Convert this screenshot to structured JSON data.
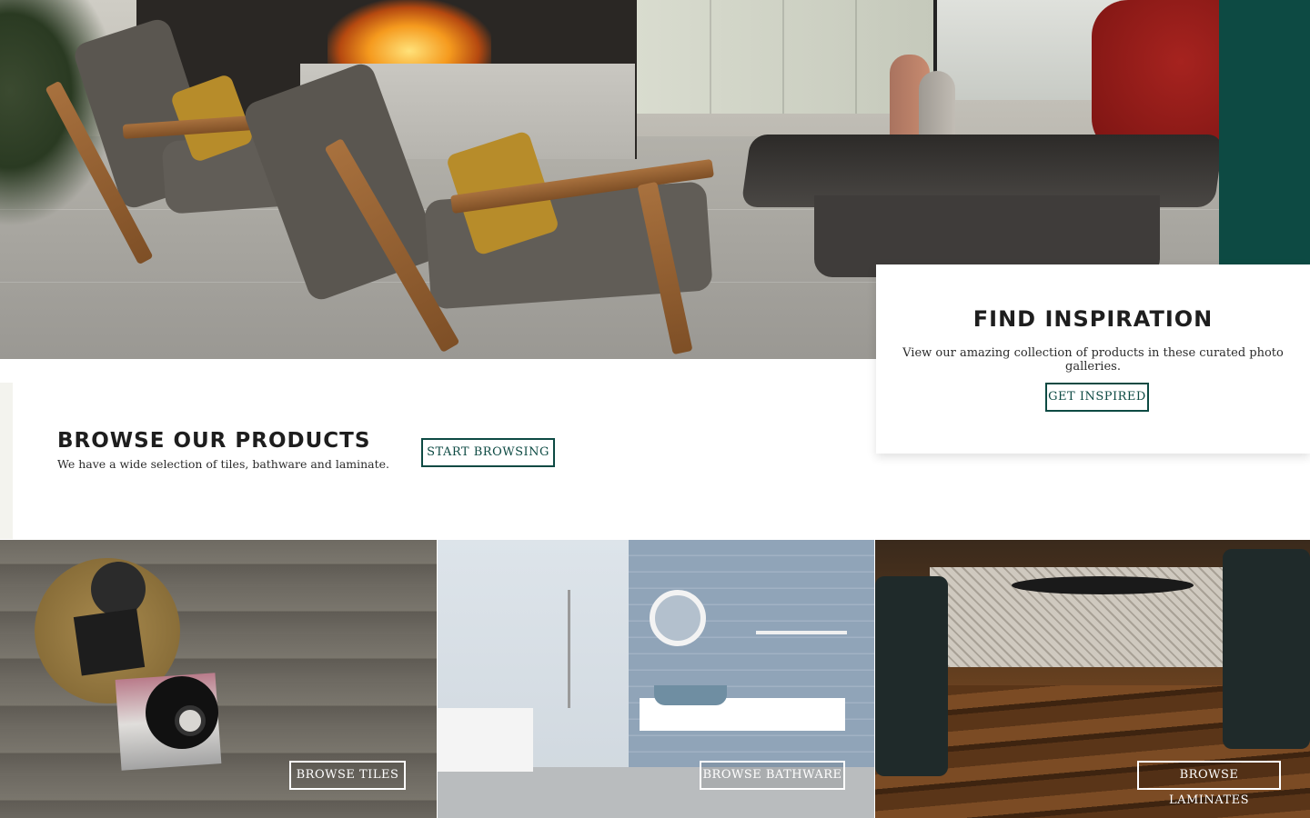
{
  "hero": {
    "image_alt": "Living room with wooden lounge chairs, fireplace and glass coffee table"
  },
  "inspiration": {
    "title": "FIND INSPIRATION",
    "description": "View our amazing collection of products in these curated photo galleries.",
    "button_label": "GET INSPIRED"
  },
  "browse": {
    "title": "BROWSE OUR PRODUCTS",
    "description": "We have a wide selection of tiles, bathware and laminate.",
    "button_label": "START BROWSING"
  },
  "categories": [
    {
      "name": "tiles",
      "button_label": "BROWSE TILES"
    },
    {
      "name": "bathware",
      "button_label": "BROWSE BATHWARE"
    },
    {
      "name": "laminates",
      "button_label": "BROWSE LAMINATES"
    }
  ],
  "colors": {
    "accent": "#0d4a43",
    "text_dark": "#1e1e1e",
    "white": "#ffffff"
  }
}
